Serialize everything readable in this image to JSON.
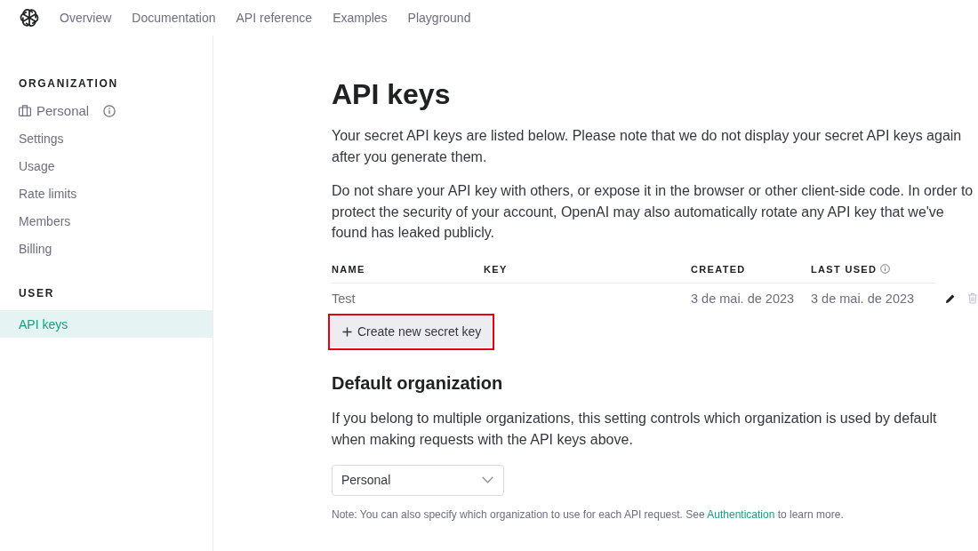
{
  "nav": {
    "links": [
      {
        "label": "Overview",
        "selected": false
      },
      {
        "label": "Documentation",
        "selected": false
      },
      {
        "label": "API reference",
        "selected": false
      },
      {
        "label": "Examples",
        "selected": false
      },
      {
        "label": "Playground",
        "selected": false
      }
    ]
  },
  "sidebar": {
    "sections": [
      {
        "heading": "ORGANIZATION",
        "items": [
          {
            "kind": "organization",
            "label": "Personal",
            "selected": false
          },
          {
            "kind": "link",
            "label": "Settings",
            "selected": false
          },
          {
            "kind": "link",
            "label": "Usage",
            "selected": false
          },
          {
            "kind": "link",
            "label": "Rate limits",
            "selected": false
          },
          {
            "kind": "link",
            "label": "Members",
            "selected": false
          },
          {
            "kind": "link",
            "label": "Billing",
            "selected": false
          }
        ]
      },
      {
        "heading": "USER",
        "items": [
          {
            "kind": "link",
            "label": "API keys",
            "selected": true
          }
        ]
      }
    ]
  },
  "api_keys": {
    "title": "API keys",
    "paragraphs": [
      "Your secret API keys are listed below. Please note that we do not display your secret API keys again after you generate them.",
      "Do not share your API key with others, or expose it in the browser or other client-side code. In order to protect the security of your account, OpenAI may also automatically rotate any API key that we've found has leaked publicly."
    ],
    "table": {
      "columns": [
        {
          "label": "NAME",
          "info": false
        },
        {
          "label": "KEY",
          "info": false
        },
        {
          "label": "CREATED",
          "info": false
        },
        {
          "label": "LAST USED",
          "info": true
        }
      ],
      "rows": [
        {
          "name": "Test",
          "created": "3 de mai. de 2023",
          "last_used": "3 de mai. de 2023"
        }
      ]
    },
    "create_button": {
      "label": "Create new secret key",
      "highlighted": true
    }
  },
  "default_organization": {
    "title": "Default organization",
    "description": "If you belong to multiple organizations, this setting controls which organization is used by default when making requests with the API keys above.",
    "select": {
      "value": "Personal"
    },
    "note": {
      "text": "Note: You can also specify which organization to use for each API request. See",
      "link": "Authentication",
      "after": "to learn more."
    }
  }
}
